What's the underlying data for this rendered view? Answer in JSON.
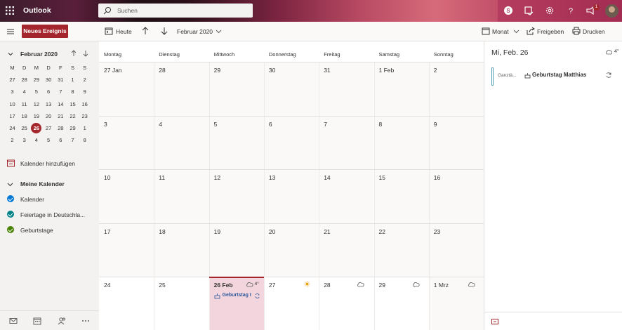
{
  "app": {
    "brand": "Outlook"
  },
  "search": {
    "placeholder": "Suchen"
  },
  "topbar": {
    "notification_count": "1"
  },
  "toolbar": {
    "new_event_label": "Neues Ereignis",
    "today_label": "Heute",
    "month_picker_label": "Februar 2020",
    "view_label": "Monat",
    "share_label": "Freigeben",
    "print_label": "Drucken"
  },
  "mini_calendar": {
    "title": "Februar 2020",
    "weekday_headers": [
      "M",
      "D",
      "M",
      "D",
      "F",
      "S",
      "S"
    ],
    "weeks": [
      [
        "27",
        "28",
        "29",
        "30",
        "31",
        "1",
        "2"
      ],
      [
        "3",
        "4",
        "5",
        "6",
        "7",
        "8",
        "9"
      ],
      [
        "10",
        "11",
        "12",
        "13",
        "14",
        "15",
        "16"
      ],
      [
        "17",
        "18",
        "19",
        "20",
        "21",
        "22",
        "23"
      ],
      [
        "24",
        "25",
        "26",
        "27",
        "28",
        "29",
        "1"
      ],
      [
        "2",
        "3",
        "4",
        "5",
        "6",
        "7",
        "8"
      ]
    ],
    "today": "26"
  },
  "sidebar": {
    "add_calendar_label": "Kalender hinzufügen",
    "group_label": "Meine Kalender",
    "calendars": [
      {
        "label": "Kalender",
        "color": "#0078d4"
      },
      {
        "label": "Feiertage in Deutschla...",
        "color": "#038387"
      },
      {
        "label": "Geburtstage",
        "color": "#498205"
      }
    ]
  },
  "calendar": {
    "weekdays": [
      "Montag",
      "Dienstag",
      "Mittwoch",
      "Donnerstag",
      "Freitag",
      "Samstag",
      "Sonntag"
    ],
    "weeks": [
      [
        "27 Jan",
        "28",
        "29",
        "30",
        "31",
        "1 Feb",
        "2"
      ],
      [
        "3",
        "4",
        "5",
        "6",
        "7",
        "8",
        "9"
      ],
      [
        "10",
        "11",
        "12",
        "13",
        "14",
        "15",
        "16"
      ],
      [
        "17",
        "18",
        "19",
        "20",
        "21",
        "22",
        "23"
      ],
      [
        "24",
        "25",
        "26 Feb",
        "27",
        "28",
        "29",
        "1 Mrz"
      ]
    ],
    "weather": {
      "wed_temp": "4°"
    },
    "event_chip": "Geburtstag I"
  },
  "right_pane": {
    "date_title": "Mi, Feb. 26",
    "temp": "4°",
    "event_time": "Ganztä...",
    "event_title": "Geburtstag Matthias"
  },
  "colors": {
    "accent": "#a4262c",
    "selected_day": "#f2d5dd"
  }
}
